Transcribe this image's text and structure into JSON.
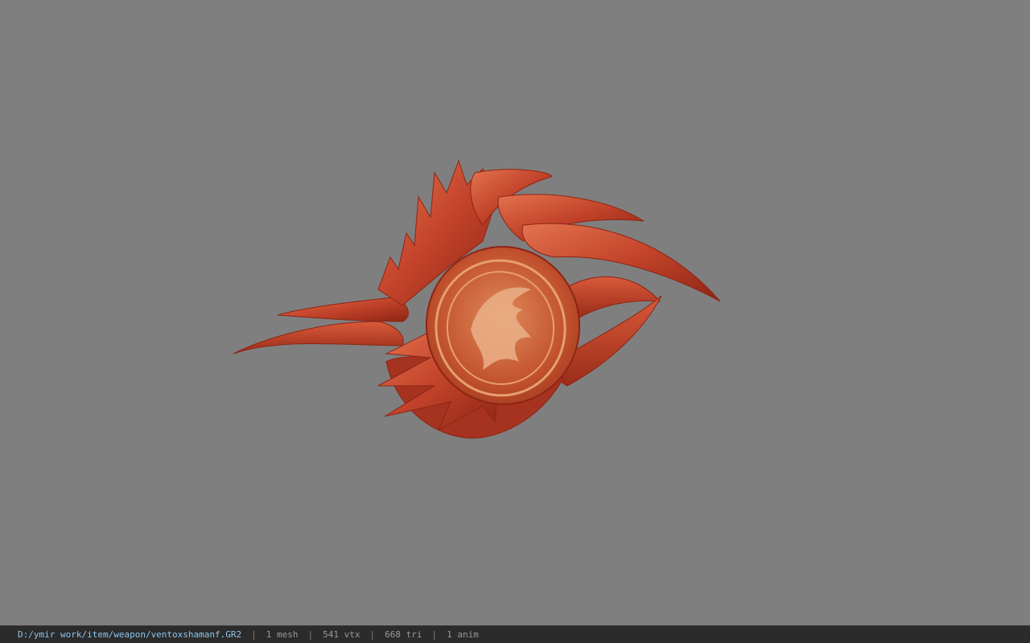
{
  "viewport": {
    "background_color": "#7f7f7f",
    "model_colors": {
      "dark": "#8e2514",
      "mid": "#c0412a",
      "light": "#e06a48",
      "emblem": "#e9a474"
    }
  },
  "statusbar": {
    "file_path": "D:/ymir work/item/weapon/ventoxshamanf.GR2",
    "separator": "|",
    "mesh": "1 mesh",
    "vertices": "541 vtx",
    "triangles": "668 tri",
    "animations": "1 anim",
    "path_color": "#8cc6ee",
    "text_color": "#9a9a9a"
  }
}
